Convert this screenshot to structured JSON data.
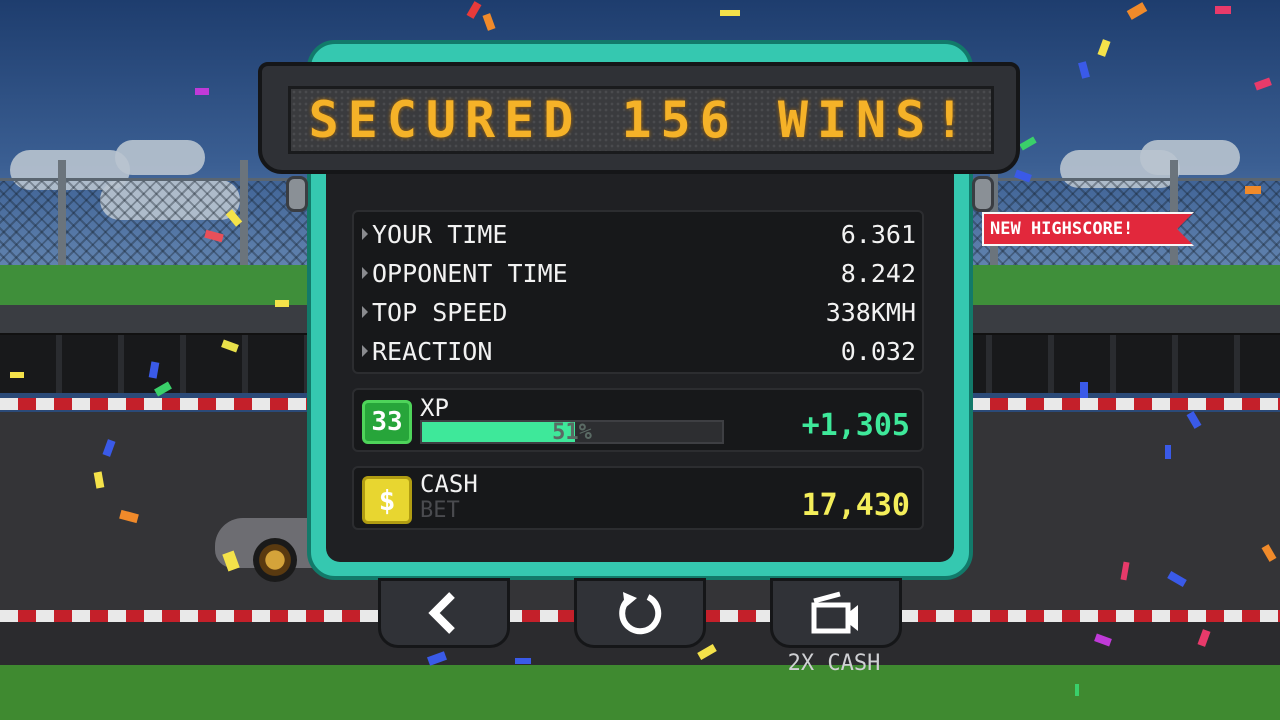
{
  "sign": {
    "title": "SECURED 156 WINS!"
  },
  "stats": [
    {
      "label": "YOUR TIME",
      "value": "6.361"
    },
    {
      "label": "OPPONENT TIME",
      "value": "8.242"
    },
    {
      "label": "TOP SPEED",
      "value": "338KMH"
    },
    {
      "label": "REACTION",
      "value": "0.032"
    }
  ],
  "badge": {
    "highscore": "NEW HIGHSCORE!"
  },
  "xp": {
    "level": "33",
    "label": "XP",
    "progress_percent": 51,
    "progress_text": "51%",
    "gain": "+1,305"
  },
  "cash": {
    "icon_glyph": "$",
    "label": "CASH",
    "bet_label": "BET",
    "value": "17,430"
  },
  "buttons": {
    "double_cash_caption": "2X CASH"
  },
  "colors": {
    "panel_teal": "#35c8b0",
    "sign_text": "#f5b228",
    "xp_green": "#3ee89a",
    "cash_yellow": "#f4ee5a",
    "ribbon_red": "#e2283c"
  },
  "icons": [
    "back-arrow-icon",
    "restart-icon",
    "video-ad-icon",
    "dollar-icon"
  ]
}
